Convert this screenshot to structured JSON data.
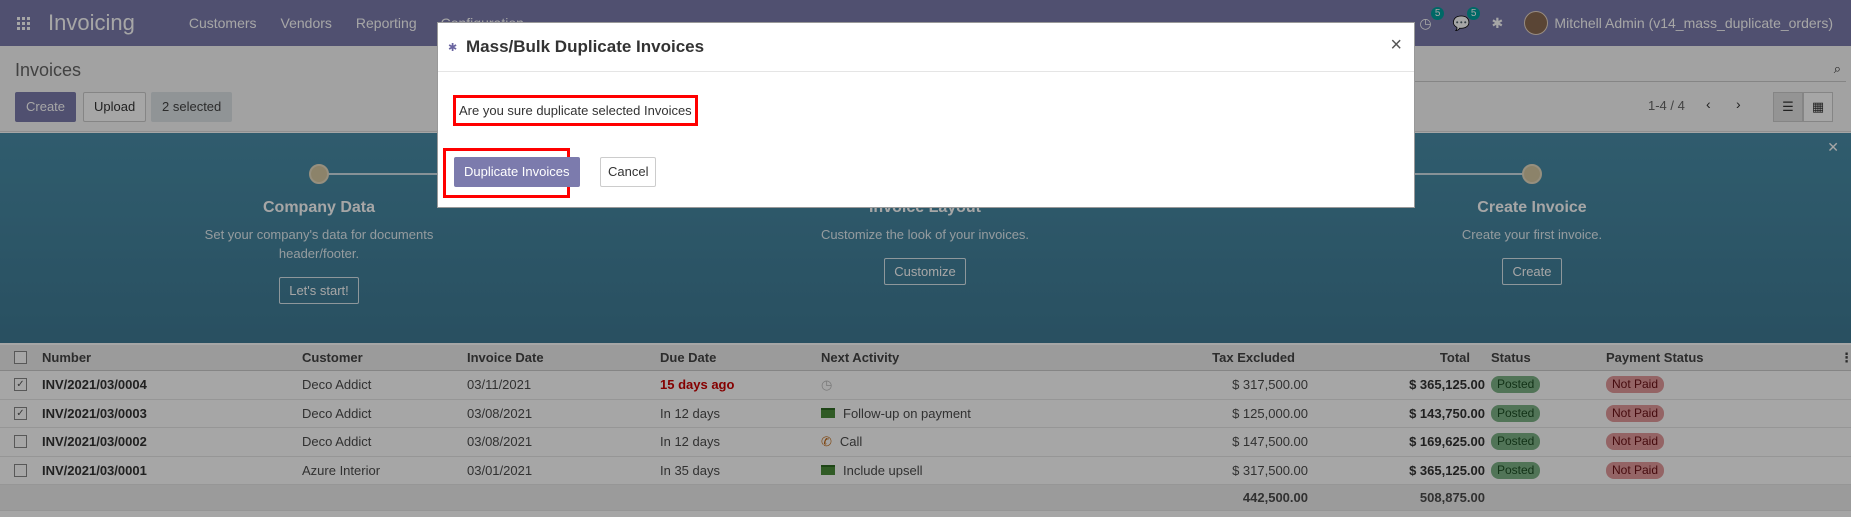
{
  "navbar": {
    "app_name": "Invoicing",
    "menu": [
      "Customers",
      "Vendors",
      "Reporting",
      "Configuration"
    ],
    "activity_count": "5",
    "messages_count": "5",
    "user": "Mitchell Admin (v14_mass_duplicate_orders)"
  },
  "control": {
    "title": "Invoices",
    "create_label": "Create",
    "upload_label": "Upload",
    "selected_label": "2 selected",
    "pager": "1-4 / 4"
  },
  "banner": {
    "steps": [
      {
        "title": "Company Data",
        "desc": "Set your company's data for documents header/footer.",
        "button": "Let's start!"
      },
      {
        "title": "Invoice Layout",
        "desc": "Customize the look of your invoices.",
        "button": "Customize"
      },
      {
        "title": "Create Invoice",
        "desc": "Create your first invoice.",
        "button": "Create"
      }
    ]
  },
  "table": {
    "headers": [
      "Number",
      "Customer",
      "Invoice Date",
      "Due Date",
      "Next Activity",
      "Tax Excluded",
      "Total",
      "Status",
      "Payment Status"
    ],
    "rows": [
      {
        "checked": true,
        "number": "INV/2021/03/0004",
        "customer": "Deco Addict",
        "invoice_date": "03/11/2021",
        "due": "15 days ago",
        "activity": "",
        "tax_excluded": "$ 317,500.00",
        "total": "$ 365,125.00",
        "status": "Posted",
        "payment": "Not Paid"
      },
      {
        "checked": true,
        "number": "INV/2021/03/0003",
        "customer": "Deco Addict",
        "invoice_date": "03/08/2021",
        "due": "In 12 days",
        "activity": "Follow-up on payment",
        "tax_excluded": "$ 125,000.00",
        "total": "$ 143,750.00",
        "status": "Posted",
        "payment": "Not Paid"
      },
      {
        "checked": false,
        "number": "INV/2021/03/0002",
        "customer": "Deco Addict",
        "invoice_date": "03/08/2021",
        "due": "In 12 days",
        "activity": "Call",
        "tax_excluded": "$ 147,500.00",
        "total": "$ 169,625.00",
        "status": "Posted",
        "payment": "Not Paid"
      },
      {
        "checked": false,
        "number": "INV/2021/03/0001",
        "customer": "Azure Interior",
        "invoice_date": "03/01/2021",
        "due": "In 35 days",
        "activity": "Include upsell",
        "tax_excluded": "$ 317,500.00",
        "total": "$ 365,125.00",
        "status": "Posted",
        "payment": "Not Paid"
      }
    ],
    "footer": {
      "tax_excluded": "442,500.00",
      "total": "508,875.00"
    }
  },
  "modal": {
    "title": "Mass/Bulk Duplicate Invoices",
    "message": "Are you sure duplicate selected Invoices",
    "duplicate_label": "Duplicate Invoices",
    "cancel_label": "Cancel"
  },
  "colors": {
    "brand": "#7c7bad",
    "highlight": "#ff0000",
    "posted": "#7db386",
    "not_paid": "#e49a9c",
    "overdue": "#cc0000"
  }
}
